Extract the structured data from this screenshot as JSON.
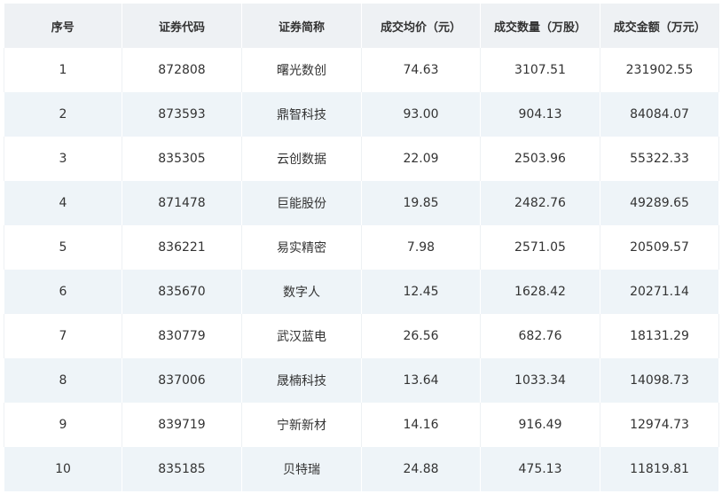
{
  "table": {
    "headers": [
      "序号",
      "证券代码",
      "证券简称",
      "成交均价（元）",
      "成交数量（万股）",
      "成交金额（万元）"
    ],
    "rows": [
      [
        "1",
        "872808",
        "曙光数创",
        "74.63",
        "3107.51",
        "231902.55"
      ],
      [
        "2",
        "873593",
        "鼎智科技",
        "93.00",
        "904.13",
        "84084.07"
      ],
      [
        "3",
        "835305",
        "云创数据",
        "22.09",
        "2503.96",
        "55322.33"
      ],
      [
        "4",
        "871478",
        "巨能股份",
        "19.85",
        "2482.76",
        "49289.65"
      ],
      [
        "5",
        "836221",
        "易实精密",
        "7.98",
        "2571.05",
        "20509.57"
      ],
      [
        "6",
        "835670",
        "数字人",
        "12.45",
        "1628.42",
        "20271.14"
      ],
      [
        "7",
        "830779",
        "武汉蓝电",
        "26.56",
        "682.76",
        "18131.29"
      ],
      [
        "8",
        "837006",
        "晟楠科技",
        "13.64",
        "1033.34",
        "14098.73"
      ],
      [
        "9",
        "839719",
        "宁新新材",
        "14.16",
        "916.49",
        "12974.73"
      ],
      [
        "10",
        "835185",
        "贝特瑞",
        "24.88",
        "475.13",
        "11819.81"
      ]
    ]
  }
}
